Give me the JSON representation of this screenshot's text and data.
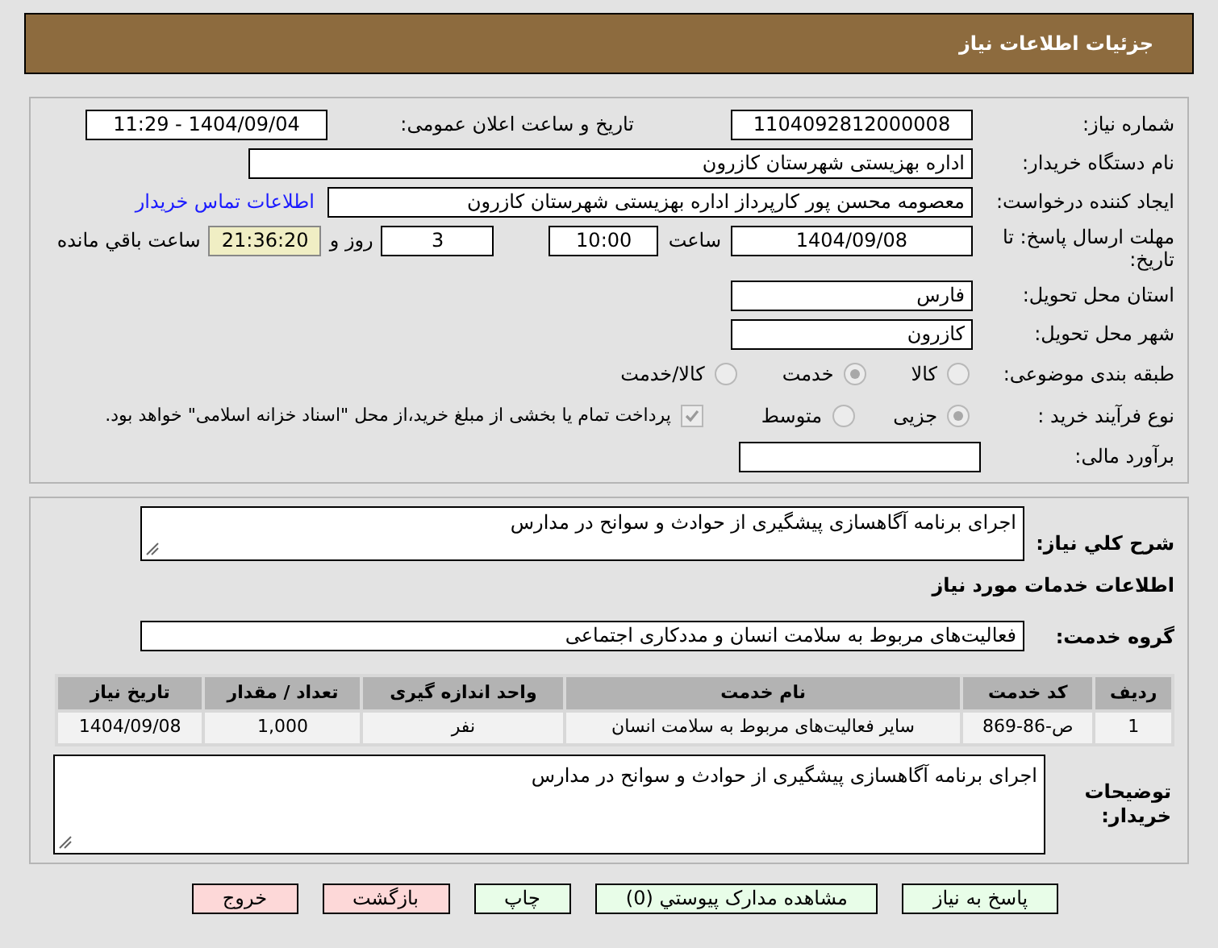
{
  "header": {
    "title": "جزئیات اطلاعات نیاز"
  },
  "need_number": {
    "label": "شماره نیاز:",
    "value": "1104092812000008"
  },
  "announce": {
    "label": "تاریخ و ساعت اعلان عمومی:",
    "value": "1404/09/04 - 11:29"
  },
  "buyer_org": {
    "label": "نام دستگاه خریدار:",
    "value": "اداره بهزیستی شهرستان کازرون"
  },
  "creator": {
    "label": "ایجاد کننده درخواست:",
    "value": "معصومه محسن پور کارپرداز اداره بهزیستی شهرستان کازرون",
    "link": "اطلاعات تماس خریدار"
  },
  "deadline": {
    "label": "مهلت ارسال پاسخ: تا تاریخ:",
    "date": "1404/09/08",
    "time_label": "ساعت",
    "time": "10:00",
    "days": "3",
    "days_label": "روز و",
    "remaining": "21:36:20",
    "remaining_label": "ساعت باقي مانده"
  },
  "province": {
    "label": "استان محل تحویل:",
    "value": "فارس"
  },
  "city": {
    "label": "شهر محل تحویل:",
    "value": "کازرون"
  },
  "category": {
    "label": "طبقه بندی موضوعی:",
    "options": [
      {
        "label": "کالا",
        "selected": false
      },
      {
        "label": "خدمت",
        "selected": true
      },
      {
        "label": "کالا/خدمت",
        "selected": false
      }
    ]
  },
  "purchase_type": {
    "label": "نوع فرآیند خرید :",
    "options": [
      {
        "label": "جزیی",
        "selected": true
      },
      {
        "label": "متوسط",
        "selected": false
      }
    ],
    "payment_checked": true,
    "payment_note": "پرداخت تمام یا بخشی از مبلغ خرید،از محل \"اسناد خزانه اسلامی\" خواهد بود."
  },
  "budget": {
    "label": "برآورد مالی:"
  },
  "description": {
    "label": "شرح كلي نیاز:",
    "value": "اجرای برنامه آگاهسازی پیشگیری از حوادث و سوانح در مدارس"
  },
  "services_title": "اطلاعات خدمات مورد نیاز",
  "service_group": {
    "label": "گروه خدمت:",
    "value": "فعالیت‌های مربوط به سلامت انسان و مددکاری اجتماعی"
  },
  "table": {
    "columns": [
      "ردیف",
      "کد خدمت",
      "نام خدمت",
      "واحد اندازه گیری",
      "تعداد / مقدار",
      "تاریخ نیاز"
    ],
    "rows": [
      [
        "1",
        "ص-86-869",
        "سایر فعالیت‌های مربوط به سلامت انسان",
        "نفر",
        "1,000",
        "1404/09/08"
      ]
    ]
  },
  "buyer_notes": {
    "label": "توضیحات خریدار:",
    "value": "اجرای برنامه آگاهسازی پیشگیری از حوادث و سوانح در مدارس"
  },
  "buttons": [
    {
      "label": "پاسخ به نیاز",
      "kind": "action"
    },
    {
      "label": "مشاهده مدارک پیوستي (0)",
      "kind": "action"
    },
    {
      "label": "چاپ",
      "kind": "action"
    },
    {
      "label": "بازگشت",
      "kind": "exit"
    },
    {
      "label": "خروج",
      "kind": "exit"
    }
  ]
}
